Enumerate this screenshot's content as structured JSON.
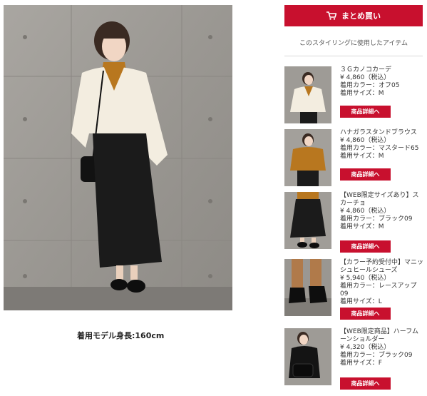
{
  "main": {
    "model_height": "着用モデル身長:160cm"
  },
  "sidebar": {
    "bulk_buy_label": "まとめ買い",
    "bulk_buy_icon": "cart-icon",
    "section_title": "このスタイリングに使用したアイテム",
    "accent_color": "#c8102e",
    "items": [
      {
        "name": "３Ｇカノコカーデ",
        "price": "¥ 4,860（税込）",
        "color": "着用カラー：オフ05",
        "size": "着用サイズ：M",
        "button": "商品詳細へ"
      },
      {
        "name": "ハナガラスタンドブラウス",
        "price": "¥ 4,860（税込）",
        "color": "着用カラー：マスタード65",
        "size": "着用サイズ：M",
        "button": "商品詳細へ"
      },
      {
        "name": "【WEB限定サイズあり】スカーチョ",
        "price": "¥ 4,860（税込）",
        "color": "着用カラー：ブラック09",
        "size": "着用サイズ：M",
        "button": "商品詳細へ"
      },
      {
        "name": "【カラー予約受付中】マニッシュヒールシューズ",
        "price": "¥ 5,940（税込）",
        "color": "着用カラー：レースアップ09",
        "size": "着用サイズ：L",
        "button": "商品詳細へ"
      },
      {
        "name": "【WEB限定商品】ハーフムーンショルダー",
        "price": "¥ 4,320（税込）",
        "color": "着用カラー：ブラック09",
        "size": "着用サイズ：F",
        "button": "商品詳細へ"
      }
    ]
  }
}
